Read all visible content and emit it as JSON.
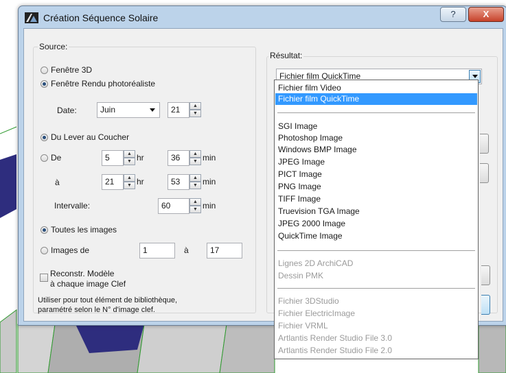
{
  "window": {
    "title": "Création Séquence Solaire",
    "help_glyph": "?",
    "close_glyph": "X"
  },
  "source": {
    "label": "Source:",
    "fenetre_3d": "Fenêtre 3D",
    "fenetre_rendu": "Fenêtre Rendu photoréaliste",
    "date_label": "Date:",
    "month": "Juin",
    "day": "21",
    "lever_coucher": "Du Lever au Coucher",
    "de_label": "De",
    "a_label": "à",
    "from_hr": "5",
    "from_min": "36",
    "to_hr": "21",
    "to_min": "53",
    "hr_unit": "hr",
    "min_unit": "min",
    "intervalle_label": "Intervalle:",
    "intervalle_value": "60",
    "toutes_images": "Toutes les images",
    "images_de": "Images de",
    "images_from": "1",
    "images_a": "à",
    "images_to": "17",
    "reconstr_line1": "Reconstr. Modèle",
    "reconstr_line2": "à chaque image Clef",
    "note_line1": "Utiliser pour tout élément de bibliothèque,",
    "note_line2": "paramétré selon le N° d'image clef."
  },
  "resultat": {
    "label": "Résultat:",
    "selected": "Fichier film QuickTime",
    "options_group1": [
      "Fichier film Video",
      "Fichier film QuickTime"
    ],
    "options_group2": [
      "SGI Image",
      "Photoshop Image",
      "Windows BMP Image",
      "JPEG Image",
      "PICT Image",
      "PNG Image",
      "TIFF Image",
      "Truevision TGA Image",
      "JPEG 2000 Image",
      "QuickTime Image"
    ],
    "options_group3": [
      "Lignes 2D ArchiCAD",
      "Dessin PMK"
    ],
    "options_group4": [
      "Fichier 3DStudio",
      "Fichier ElectricImage",
      "Fichier VRML",
      "Artlantis Render Studio File 3.0",
      "Artlantis Render Studio File 2.0"
    ]
  },
  "colors": {
    "selection": "#3399ff",
    "disabled_text": "#9a9a9a",
    "radio_dot": "#2a4f7c"
  }
}
